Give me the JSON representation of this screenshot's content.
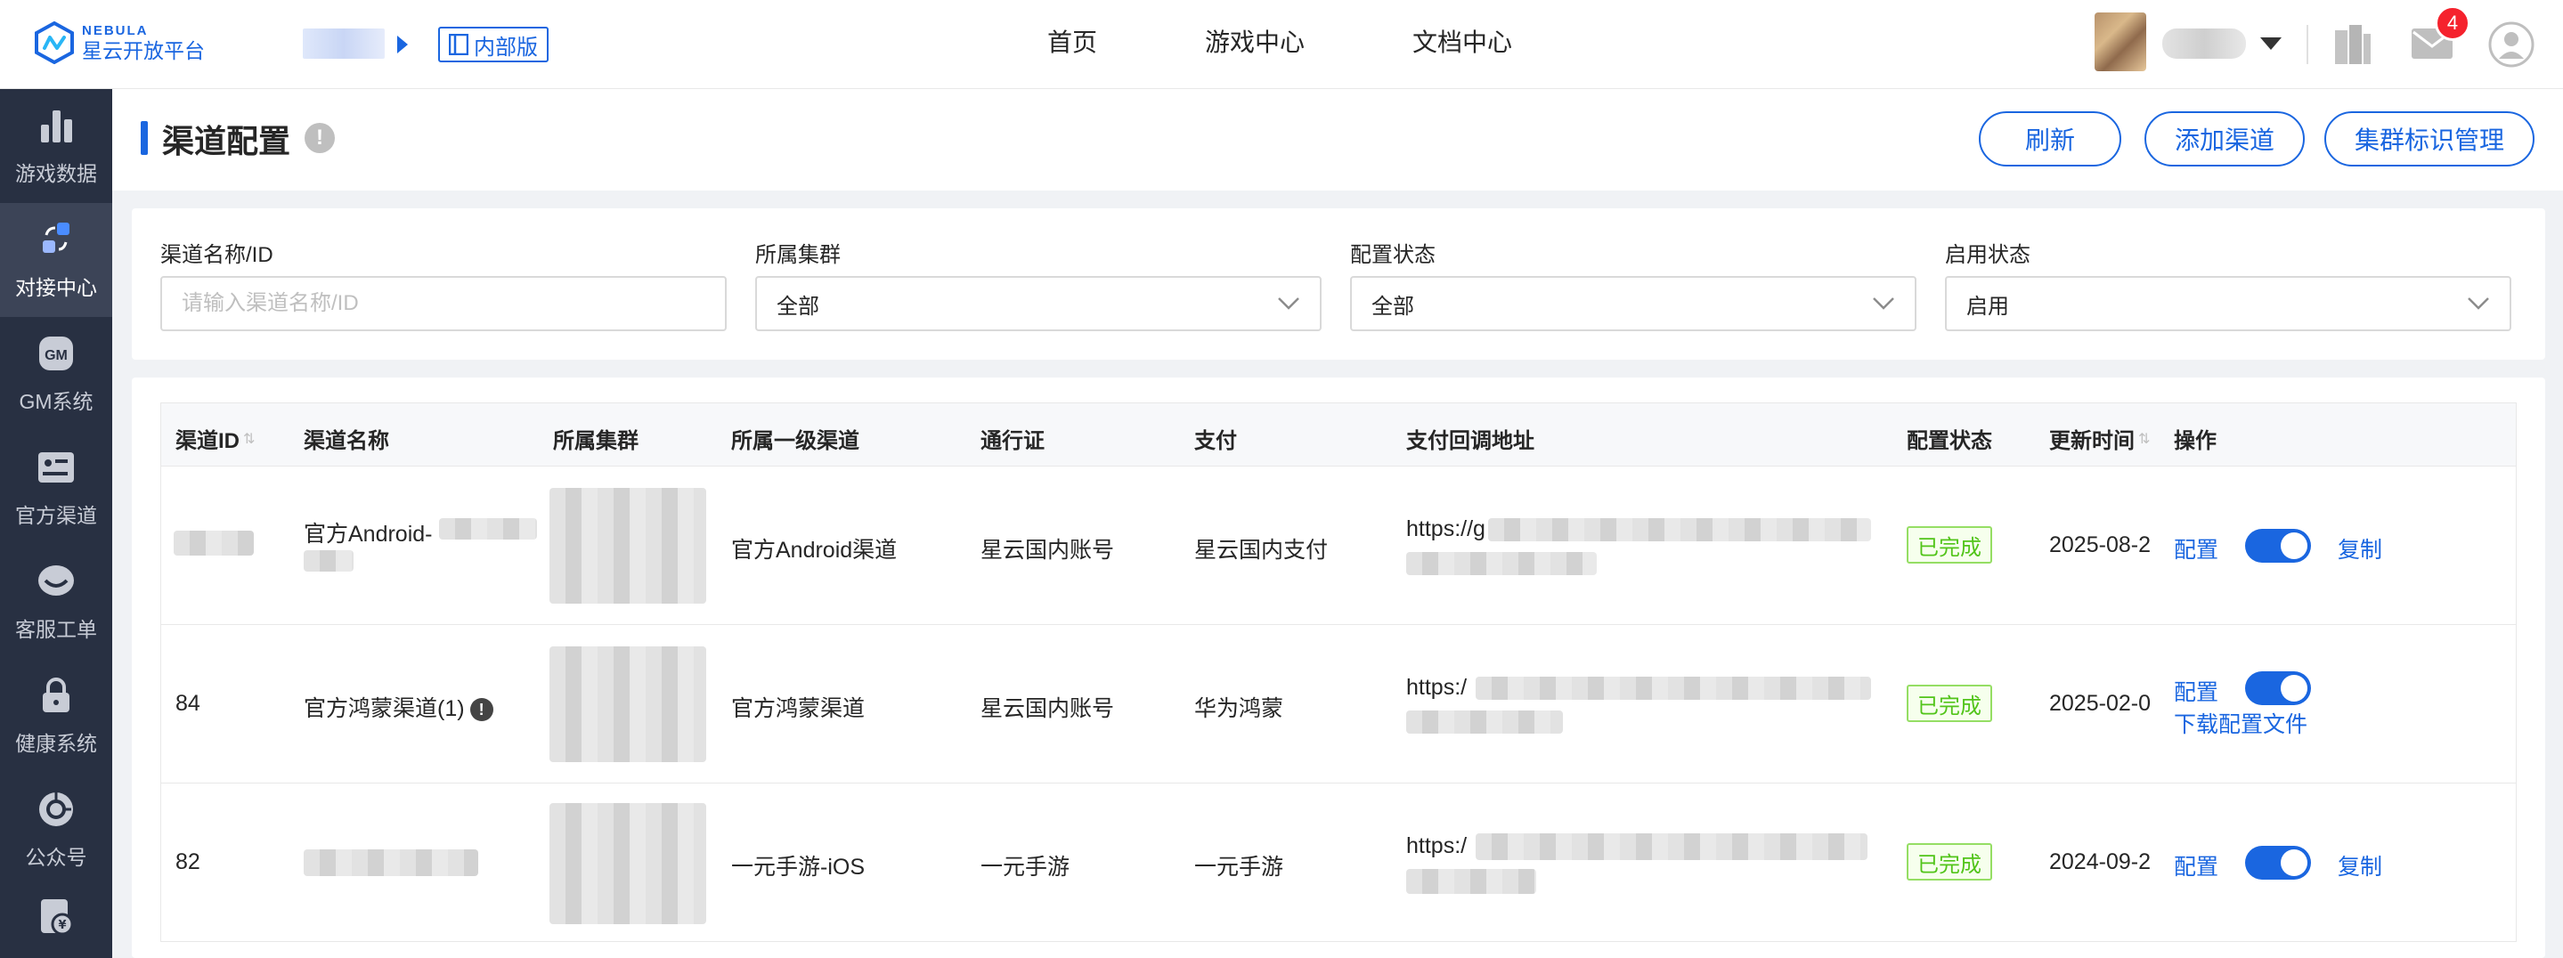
{
  "brand": {
    "en": "NEBULA",
    "cn": "星云开放平台",
    "accent": "#1a66e0"
  },
  "header": {
    "badge": "内部版",
    "nav": [
      "首页",
      "游戏中心",
      "文档中心"
    ],
    "mail_count": "4"
  },
  "sidebar": {
    "items": [
      {
        "label": "游戏数据",
        "icon": "bar-chart-icon"
      },
      {
        "label": "对接中心",
        "icon": "connect-icon",
        "active": true
      },
      {
        "label": "GM系统",
        "icon": "gm-icon"
      },
      {
        "label": "官方渠道",
        "icon": "id-card-icon"
      },
      {
        "label": "客服工单",
        "icon": "headset-icon"
      },
      {
        "label": "健康系统",
        "icon": "lock-icon"
      },
      {
        "label": "公众号",
        "icon": "aperture-icon"
      },
      {
        "label": "",
        "icon": "bill-icon"
      }
    ]
  },
  "page": {
    "title": "渠道配置",
    "buttons": {
      "refresh": "刷新",
      "add": "添加渠道",
      "cluster": "集群标识管理"
    }
  },
  "filters": {
    "name": {
      "label": "渠道名称/ID",
      "placeholder": "请输入渠道名称/ID"
    },
    "cluster": {
      "label": "所属集群",
      "value": "全部"
    },
    "config_status": {
      "label": "配置状态",
      "value": "全部"
    },
    "enable_status": {
      "label": "启用状态",
      "value": "启用"
    }
  },
  "table": {
    "columns": [
      "渠道ID",
      "渠道名称",
      "所属集群",
      "所属一级渠道",
      "通行证",
      "支付",
      "支付回调地址",
      "配置状态",
      "更新时间",
      "操作"
    ],
    "rows": [
      {
        "id": "",
        "name": "官方Android-",
        "parent_channel": "官方Android渠道",
        "passport": "星云国内账号",
        "payment": "星云国内支付",
        "callback": "https://g",
        "status": "已完成",
        "updated": "2025-08-2",
        "action_config": "配置",
        "action_extra": "复制"
      },
      {
        "id": "84",
        "name": "官方鸿蒙渠道(1)",
        "parent_channel": "官方鸿蒙渠道",
        "passport": "星云国内账号",
        "payment": "华为鸿蒙",
        "callback": "https:/",
        "status": "已完成",
        "updated": "2025-02-0",
        "action_config": "配置",
        "action_extra": "下载配置文件"
      },
      {
        "id": "82",
        "name": "",
        "parent_channel": "一元手游-iOS",
        "passport": "一元手游",
        "payment": "一元手游",
        "callback": "https:/",
        "status": "已完成",
        "updated": "2024-09-2",
        "action_config": "配置",
        "action_extra": "复制"
      }
    ]
  }
}
